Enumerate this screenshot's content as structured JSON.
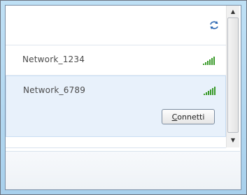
{
  "networks": [
    {
      "name": "Network_1234",
      "signal_icon": "signal-bars-icon"
    },
    {
      "name": "Network_6789",
      "signal_icon": "signal-bars-icon",
      "selected": true
    }
  ],
  "connect_button": {
    "label": "Connetti"
  },
  "icons": {
    "refresh": "refresh-icon",
    "scroll_up": "chevron-up-icon",
    "scroll_down": "chevron-down-icon"
  },
  "colors": {
    "selection_bg": "#e8f1fb",
    "signal_green": "#3a9a2a",
    "frame_blue": "#a8d0ec"
  }
}
